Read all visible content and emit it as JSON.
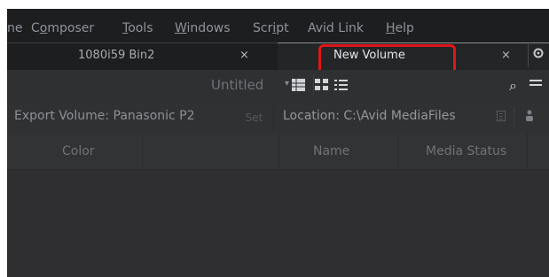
{
  "menu": {
    "items": [
      {
        "pre": "",
        "u": "",
        "post": "ne"
      },
      {
        "pre": "C",
        "u": "o",
        "post": "mposer"
      },
      {
        "pre": "",
        "u": "T",
        "post": "ools"
      },
      {
        "pre": "",
        "u": "W",
        "post": "indows"
      },
      {
        "pre": "Scr",
        "u": "i",
        "post": "pt"
      },
      {
        "pre": "Avid Link",
        "u": "",
        "post": ""
      },
      {
        "pre": "",
        "u": "H",
        "post": "elp"
      }
    ]
  },
  "tabs": [
    {
      "label": "1080i59 Bin2",
      "close": "×"
    },
    {
      "label": "New Volume",
      "close": "×"
    }
  ],
  "toolbar": {
    "view_name": "Untitled",
    "view_caret": "▾",
    "search_glyph": "⌕"
  },
  "export": {
    "label": "Export Volume: Panasonic P2",
    "set_label": "Set",
    "location": "Location: C:\\Avid MediaFiles"
  },
  "columns": [
    "Color",
    "Name",
    "Media Status"
  ],
  "icons": {
    "gear": "gear-icon",
    "search": "search-icon",
    "menu": "hamburger-menu-icon",
    "frame_view": "frame-view-icon",
    "script_view": "script-view-icon",
    "list_view": "list-view-icon",
    "folder": "folder-icon",
    "person": "person-icon"
  },
  "colors": {
    "highlight": "#e01616",
    "panel_bg": "#2f2f31",
    "menubar_bg": "#1d1e20",
    "view_icon": "#d3d5d8"
  }
}
